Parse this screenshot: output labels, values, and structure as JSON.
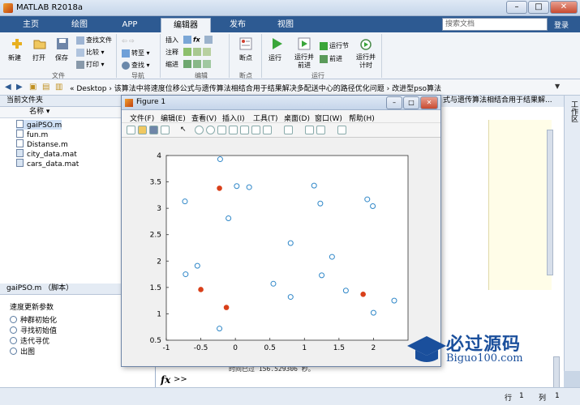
{
  "window": {
    "title": "MATLAB R2018a",
    "controls": [
      "–",
      "□",
      "✕"
    ]
  },
  "ribbon_tabs": [
    "主页",
    "绘图",
    "APP",
    "编辑器",
    "发布",
    "视图"
  ],
  "active_tab": "编辑器",
  "search": {
    "placeholder": "搜索文档",
    "collapse_label": "登录"
  },
  "ribbon": {
    "file_group": {
      "label": "文件",
      "new": "新建",
      "open": "打开",
      "save": "保存",
      "find_files": "查找文件",
      "compare": "比较",
      "print": "打印"
    },
    "nav_group": {
      "label": "导航",
      "goto": "转至",
      "find": "查找"
    },
    "edit_group": {
      "label": "编辑",
      "insert": "插入",
      "comment": "注释",
      "indent": "缩进",
      "fx": "fx"
    },
    "breakpoint_group": {
      "label": "断点",
      "breakpoints": "断点"
    },
    "run_group": {
      "label": "运行",
      "run": "运行",
      "run_advance": "运行并前进",
      "run_section": "运行节",
      "advance": "前进",
      "run_time": "运行并计时"
    }
  },
  "address": {
    "path": "« Desktop › 该算法中将速度位移公式与遗传算法相结合用于结果解决多配送中心的路径优化问题 › 改进型pso算法"
  },
  "current_folder": {
    "header": "当前文件夹",
    "column": "名称 ▾",
    "files": [
      {
        "name": "gaiPSO.m",
        "selected": true
      },
      {
        "name": "fun.m",
        "selected": false
      },
      {
        "name": "Distanse.m",
        "selected": false
      },
      {
        "name": "city_data.mat",
        "selected": false
      },
      {
        "name": "cars_data.mat",
        "selected": false
      }
    ]
  },
  "details": {
    "header": "gaiPSO.m （脚本）",
    "title": "速度更新参数",
    "items": [
      "种群初始化",
      "寻找初始值",
      "迭代寻优",
      "出图"
    ]
  },
  "editor": {
    "tab_label": "式与遗传算法相结合用于结果解...",
    "side_label": "工作区"
  },
  "command_window": {
    "output": "时间已过 156.529306 秒。",
    "fx": "fx",
    "prompt": ">>"
  },
  "status": {
    "row_label": "行",
    "row_value": "1",
    "col_label": "列",
    "col_value": "1"
  },
  "figure": {
    "title": "Figure 1",
    "menus": [
      "文件(F)",
      "编辑(E)",
      "查看(V)",
      "插入(I)",
      "工具(T)",
      "桌面(D)",
      "窗口(W)",
      "帮助(H)"
    ]
  },
  "watermark": {
    "cn": "必过源码",
    "en": "Biguo100.com"
  },
  "colors": {
    "customer": "#2f87c8",
    "center": "#d9401a",
    "accent": "#2d5a92"
  },
  "chart_data": {
    "type": "scatter",
    "title": "",
    "xlabel": "",
    "ylabel": "",
    "xlim": [
      -1,
      2.5
    ],
    "ylim": [
      0.5,
      4
    ],
    "xticks": [
      -1,
      -0.5,
      0,
      0.5,
      1,
      1.5,
      2
    ],
    "yticks": [
      0.5,
      1,
      1.5,
      2,
      2.5,
      3,
      3.5,
      4
    ],
    "grid": false,
    "series": [
      {
        "marker": "circle-open",
        "color": "#2f87c8",
        "points": [
          [
            -0.22,
            3.93
          ],
          [
            -0.73,
            3.13
          ],
          [
            -0.1,
            2.81
          ],
          [
            0.02,
            3.42
          ],
          [
            0.2,
            3.4
          ],
          [
            1.14,
            3.43
          ],
          [
            1.23,
            3.09
          ],
          [
            1.91,
            3.17
          ],
          [
            1.99,
            3.04
          ],
          [
            0.8,
            2.34
          ],
          [
            1.4,
            2.08
          ],
          [
            1.25,
            1.73
          ],
          [
            0.55,
            1.57
          ],
          [
            1.6,
            1.44
          ],
          [
            -0.72,
            1.75
          ],
          [
            -0.55,
            1.91
          ],
          [
            0.8,
            1.32
          ],
          [
            2.3,
            1.25
          ],
          [
            2.0,
            1.02
          ],
          [
            -0.23,
            0.72
          ]
        ]
      },
      {
        "marker": "circle-filled",
        "color": "#d9401a",
        "points": [
          [
            -0.23,
            3.38
          ],
          [
            -0.5,
            1.46
          ],
          [
            -0.13,
            1.12
          ],
          [
            1.85,
            1.37
          ]
        ]
      }
    ]
  }
}
